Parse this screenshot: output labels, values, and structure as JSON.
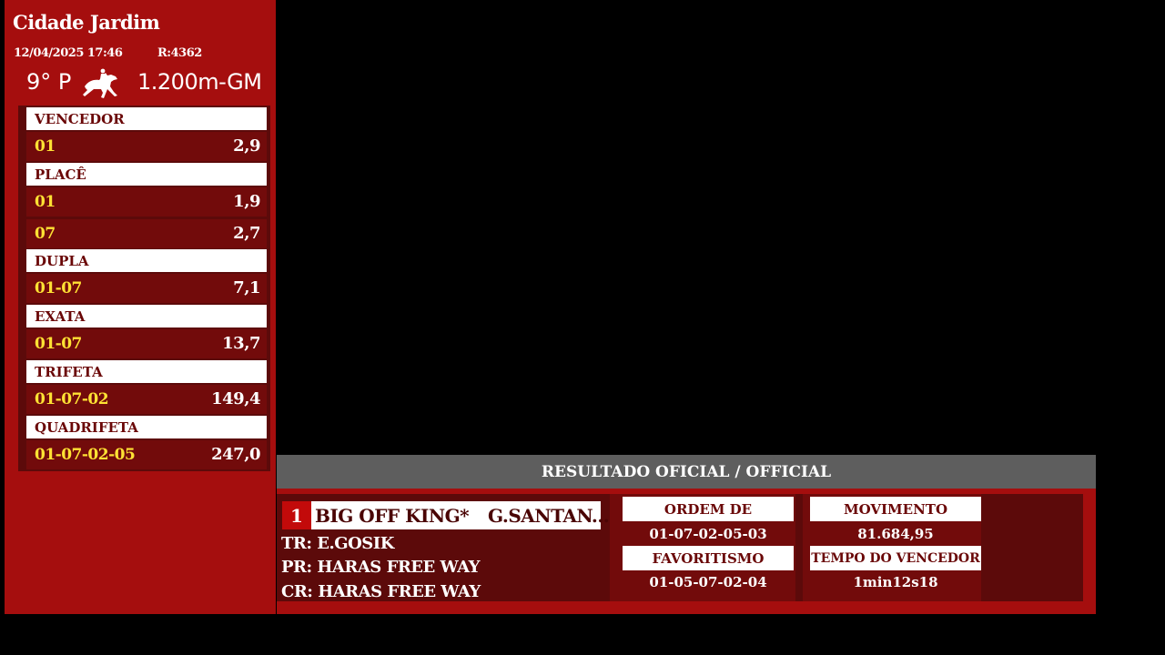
{
  "venue": "Cidade Jardim",
  "race_date": "12/04/2025 17:46",
  "race_ref": "R:4362",
  "race_number": "9° P",
  "distance": "1.200m-GM",
  "icons": {
    "horse": "horse-rider-icon"
  },
  "colors": {
    "panel_red": "#a50e0e",
    "dark_red": "#5c0a0a",
    "row_red": "#720b0b",
    "combo_yellow": "#ffe234",
    "title_gray": "#5e5e5e"
  },
  "bets": [
    {
      "name": "VENCEDOR",
      "rows": [
        {
          "combo": "01",
          "value": "2,9"
        }
      ]
    },
    {
      "name": "PLACÊ",
      "rows": [
        {
          "combo": "01",
          "value": "1,9"
        },
        {
          "combo": "07",
          "value": "2,7"
        }
      ]
    },
    {
      "name": "DUPLA",
      "rows": [
        {
          "combo": "01-07",
          "value": "7,1"
        }
      ]
    },
    {
      "name": "EXATA",
      "rows": [
        {
          "combo": "01-07",
          "value": "13,7"
        }
      ]
    },
    {
      "name": "TRIFETA",
      "rows": [
        {
          "combo": "01-07-02",
          "value": "149,4"
        }
      ]
    },
    {
      "name": "QUADRIFETA",
      "rows": [
        {
          "combo": "01-07-02-05",
          "value": "247,0"
        }
      ]
    }
  ],
  "result": {
    "title": "RESULTADO OFICIAL / OFFICIAL",
    "winner_number": "1",
    "winner_name": "BIG OFF KING*",
    "jockey": "G.SANTAN...",
    "trainer": "TR: E.GOSIK",
    "owner": "PR: HARAS FREE WAY",
    "breeder": "CR: HARAS FREE WAY",
    "arrival_label": "ORDEM DE CHEGADA",
    "arrival_value": "01-07-02-05-03",
    "favorites_label": "FAVORITISMO",
    "favorites_value": "01-05-07-02-04",
    "turnover_label": "MOVIMENTO",
    "turnover_value": "81.684,95",
    "winner_time_label": "TEMPO DO VENCEDOR",
    "winner_time_value": "1min12s18"
  }
}
